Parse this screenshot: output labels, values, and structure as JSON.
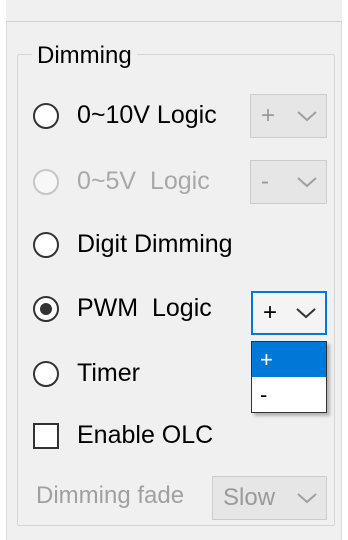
{
  "dimming": {
    "group_title": "Dimming",
    "options": [
      {
        "label": "0~10V Logic",
        "checked": false,
        "enabled": true
      },
      {
        "label": "0~5V  Logic",
        "checked": false,
        "enabled": false
      },
      {
        "label": "Digit Dimming",
        "checked": false,
        "enabled": true
      },
      {
        "label": "PWM  Logic",
        "checked": true,
        "enabled": true
      },
      {
        "label": "Timer",
        "checked": false,
        "enabled": true
      }
    ],
    "combo_0_10v": {
      "value": "+"
    },
    "combo_0_5v": {
      "value": "-"
    },
    "combo_pwm": {
      "value": "+",
      "open": true,
      "options": [
        "+",
        "-"
      ],
      "selected_index": 0
    },
    "enable_olc": {
      "label": "Enable OLC",
      "checked": false
    },
    "dimming_fade": {
      "label": "Dimming fade",
      "value": "Slow"
    }
  },
  "colors": {
    "accent": "#0078d7",
    "disabled_text": "#a8a8a8"
  }
}
